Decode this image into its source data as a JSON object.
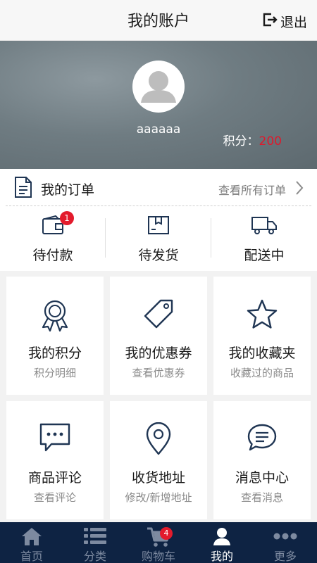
{
  "header": {
    "title": "我的账户",
    "logout_label": "退出"
  },
  "profile": {
    "username": "aaaaaa",
    "points_label": "积分：",
    "points_value": "200"
  },
  "orders": {
    "title": "我的订单",
    "view_all": "查看所有订单",
    "statuses": [
      {
        "label": "待付款",
        "icon": "wallet-icon",
        "badge": "1"
      },
      {
        "label": "待发货",
        "icon": "package-icon"
      },
      {
        "label": "配送中",
        "icon": "truck-icon"
      }
    ]
  },
  "tiles": [
    {
      "title": "我的积分",
      "subtitle": "积分明细",
      "icon": "medal-icon"
    },
    {
      "title": "我的优惠券",
      "subtitle": "查看优惠券",
      "icon": "coupon-tag-icon"
    },
    {
      "title": "我的收藏夹",
      "subtitle": "收藏过的商品",
      "icon": "star-icon"
    },
    {
      "title": "商品评论",
      "subtitle": "查看评论",
      "icon": "comment-icon"
    },
    {
      "title": "收货地址",
      "subtitle": "修改/新增地址",
      "icon": "location-pin-icon"
    },
    {
      "title": "消息中心",
      "subtitle": "查看消息",
      "icon": "message-icon"
    }
  ],
  "tabbar": {
    "items": [
      {
        "label": "首页",
        "icon": "home-icon"
      },
      {
        "label": "分类",
        "icon": "category-list-icon"
      },
      {
        "label": "购物车",
        "icon": "cart-icon",
        "badge": "4"
      },
      {
        "label": "我的",
        "icon": "user-icon",
        "active": true
      },
      {
        "label": "更多",
        "icon": "more-dots-icon"
      }
    ]
  },
  "colors": {
    "navy": "#0e2343",
    "accent_red": "#e31b2c",
    "icon_navy": "#1f3553"
  }
}
